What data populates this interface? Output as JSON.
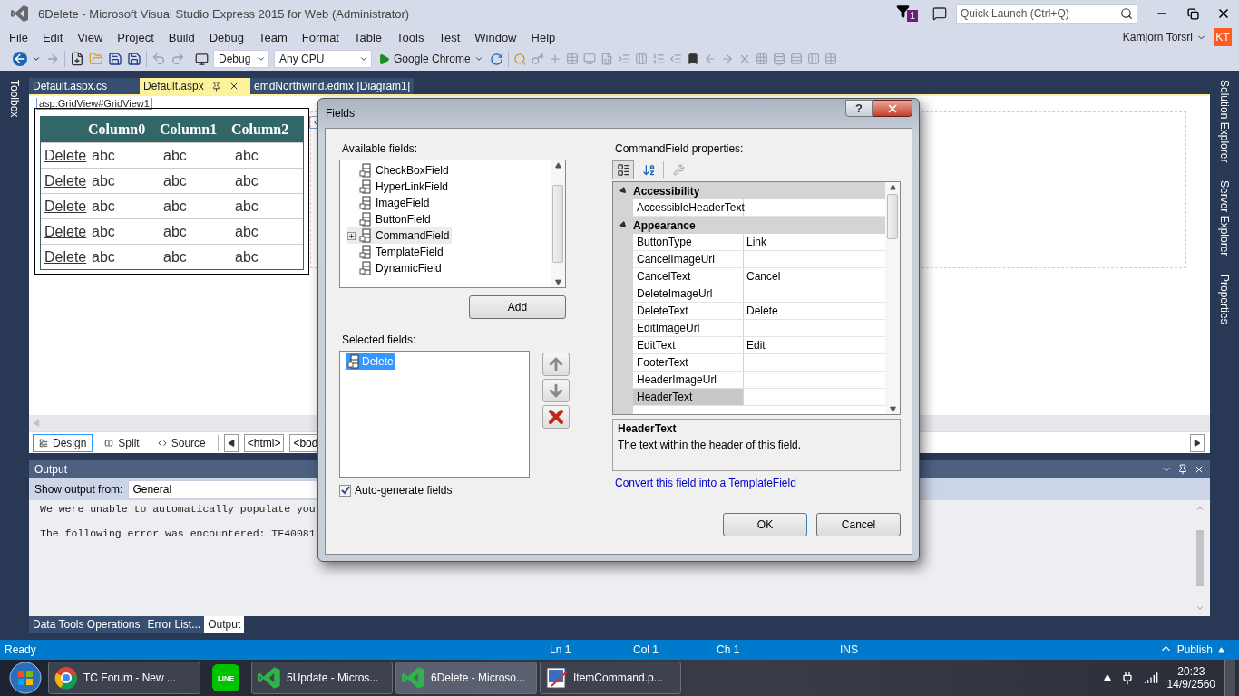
{
  "window": {
    "title": "6Delete - Microsoft Visual Studio Express 2015 for Web (Administrator)",
    "notification_count": "1",
    "quick_launch": {
      "placeholder": "Quick Launch (Ctrl+Q)"
    }
  },
  "menu": [
    "File",
    "Edit",
    "View",
    "Project",
    "Build",
    "Debug",
    "Team",
    "Format",
    "Table",
    "Tools",
    "Test",
    "Window",
    "Help"
  ],
  "user": {
    "name": "Kamjorn Torsri",
    "initials": "KT"
  },
  "toolbar": {
    "configuration": "Debug",
    "platform": "Any CPU",
    "run_target": "Google Chrome"
  },
  "side_tabs": {
    "left": [
      "Toolbox"
    ],
    "right": [
      "Solution Explorer",
      "Server Explorer",
      "Properties"
    ]
  },
  "document_tabs": [
    {
      "label": "Default.aspx.cs",
      "selected": false
    },
    {
      "label": "Default.aspx",
      "selected": true
    },
    {
      "label": "emdNorthwind.edmx [Diagram1]",
      "selected": false
    }
  ],
  "designer": {
    "element_tag": "asp:GridView#GridView1",
    "grid": {
      "columns": [
        "",
        "Column0",
        "Column1",
        "Column2"
      ],
      "rows": [
        [
          "Delete",
          "abc",
          "abc",
          "abc"
        ],
        [
          "Delete",
          "abc",
          "abc",
          "abc"
        ],
        [
          "Delete",
          "abc",
          "abc",
          "abc"
        ],
        [
          "Delete",
          "abc",
          "abc",
          "abc"
        ],
        [
          "Delete",
          "abc",
          "abc",
          "abc"
        ]
      ]
    },
    "views": [
      {
        "label": "Design",
        "selected": true
      },
      {
        "label": "Split",
        "selected": false
      },
      {
        "label": "Source",
        "selected": false
      }
    ],
    "breadcrumbs": [
      "<html>",
      "<bod"
    ]
  },
  "output": {
    "title": "Output",
    "source_label": "Show output from:",
    "source": "General",
    "lines": [
      "We were unable to automatically populate you",
      "The following error was encountered: TF40081"
    ],
    "tabs": [
      {
        "label": "Data Tools Operations",
        "selected": false
      },
      {
        "label": "Error List...",
        "selected": false
      },
      {
        "label": "Output",
        "selected": true
      }
    ]
  },
  "dialog": {
    "title": "Fields",
    "help": "?",
    "available_label": "Available fields:",
    "available": [
      {
        "label": "CheckBoxField",
        "selected": false,
        "expandable": false
      },
      {
        "label": "HyperLinkField",
        "selected": false,
        "expandable": false
      },
      {
        "label": "ImageField",
        "selected": false,
        "expandable": false
      },
      {
        "label": "ButtonField",
        "selected": false,
        "expandable": false
      },
      {
        "label": "CommandField",
        "selected": true,
        "expandable": true
      },
      {
        "label": "TemplateField",
        "selected": false,
        "expandable": false
      },
      {
        "label": "DynamicField",
        "selected": false,
        "expandable": false
      }
    ],
    "add": "Add",
    "selected_label": "Selected fields:",
    "selected_fields": [
      {
        "label": "Delete",
        "selected": true
      }
    ],
    "auto_generate": {
      "label": "Auto-generate fields",
      "checked": true
    },
    "properties_label": "CommandField properties:",
    "properties": [
      {
        "category": "Accessibility",
        "expanded": true,
        "items": [
          {
            "name": "AccessibleHeaderText",
            "selected": false
          }
        ]
      },
      {
        "category": "Appearance",
        "expanded": true,
        "items": [
          {
            "name": "ButtonType",
            "value": "Link",
            "selected": false
          },
          {
            "name": "CancelImageUrl",
            "selected": false
          },
          {
            "name": "CancelText",
            "value": "Cancel",
            "selected": false
          },
          {
            "name": "DeleteImageUrl",
            "selected": false
          },
          {
            "name": "DeleteText",
            "value": "Delete",
            "selected": false
          },
          {
            "name": "EditImageUrl",
            "selected": false
          },
          {
            "name": "EditText",
            "value": "Edit",
            "selected": false
          },
          {
            "name": "FooterText",
            "selected": false
          },
          {
            "name": "HeaderImageUrl",
            "selected": false
          },
          {
            "name": "HeaderText",
            "selected": true
          }
        ]
      }
    ],
    "description": {
      "title": "HeaderText",
      "text": "The text within the header of this field."
    },
    "convert_link": "Convert this field into a TemplateField",
    "ok": "OK",
    "cancel": "Cancel"
  },
  "status_bar": {
    "state": "Ready",
    "line": "Ln 1",
    "col": "Col 1",
    "ch": "Ch 1",
    "mode": "INS",
    "publish": "Publish"
  },
  "taskbar": {
    "items": [
      {
        "kind": "browser",
        "label": "TC Forum - New ...",
        "selected": false
      },
      {
        "kind": "chat",
        "icon_text": "LINE",
        "selected": false
      },
      {
        "kind": "ide",
        "label": "5Update - Micros...",
        "selected": false
      },
      {
        "kind": "ide",
        "label": "6Delete - Microso...",
        "selected": true
      },
      {
        "kind": "paint",
        "label": "ItemCommand.p...",
        "selected": false
      }
    ],
    "time": "20:23",
    "date": "14/9/2560"
  }
}
